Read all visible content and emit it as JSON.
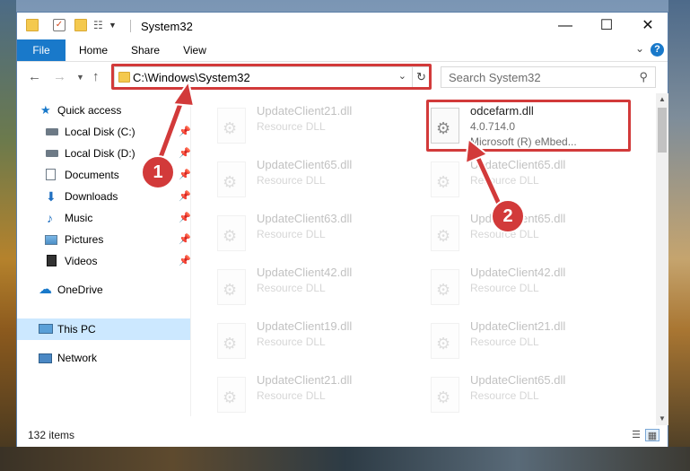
{
  "window": {
    "title": "System32",
    "controls": {
      "minimize": "—",
      "maximize": "☐",
      "close": "✕"
    }
  },
  "ribbon": {
    "tabs": [
      "File",
      "Home",
      "Share",
      "View"
    ],
    "help": "?"
  },
  "nav": {
    "address": "C:\\Windows\\System32",
    "search_placeholder": "Search System32"
  },
  "sidebar": {
    "items": [
      {
        "label": "Quick access"
      },
      {
        "label": "Local Disk (C:)"
      },
      {
        "label": "Local Disk (D:)"
      },
      {
        "label": "Documents"
      },
      {
        "label": "Downloads"
      },
      {
        "label": "Music"
      },
      {
        "label": "Pictures"
      },
      {
        "label": "Videos"
      },
      {
        "label": "OneDrive"
      },
      {
        "label": "This PC"
      },
      {
        "label": "Network"
      }
    ]
  },
  "files": {
    "left": [
      {
        "name": "UpdateClient21.dll",
        "type": "Resource DLL"
      },
      {
        "name": "UpdateClient65.dll",
        "type": "Resource DLL"
      },
      {
        "name": "UpdateClient63.dll",
        "type": "Resource DLL"
      },
      {
        "name": "UpdateClient42.dll",
        "type": "Resource DLL"
      },
      {
        "name": "UpdateClient19.dll",
        "type": "Resource DLL"
      },
      {
        "name": "UpdateClient21.dll",
        "type": "Resource DLL"
      }
    ],
    "highlighted": {
      "name": "odcefarm.dll",
      "version": "4.0.714.0",
      "publisher": "Microsoft (R) eMbed..."
    },
    "right": [
      {
        "name": "UpdateClient65.dll",
        "type": "Resource DLL"
      },
      {
        "name": "UpdateClient65.dll",
        "type": "Resource DLL"
      },
      {
        "name": "UpdateClient42.dll",
        "type": "Resource DLL"
      },
      {
        "name": "UpdateClient21.dll",
        "type": "Resource DLL"
      },
      {
        "name": "UpdateClient65.dll",
        "type": "Resource DLL"
      }
    ]
  },
  "status": {
    "items_count": "132 items"
  },
  "annotations": {
    "step1": "1",
    "step2": "2"
  },
  "colors": {
    "accent": "#1979ca",
    "highlight": "#d23a3a",
    "selected": "#cce8ff"
  }
}
